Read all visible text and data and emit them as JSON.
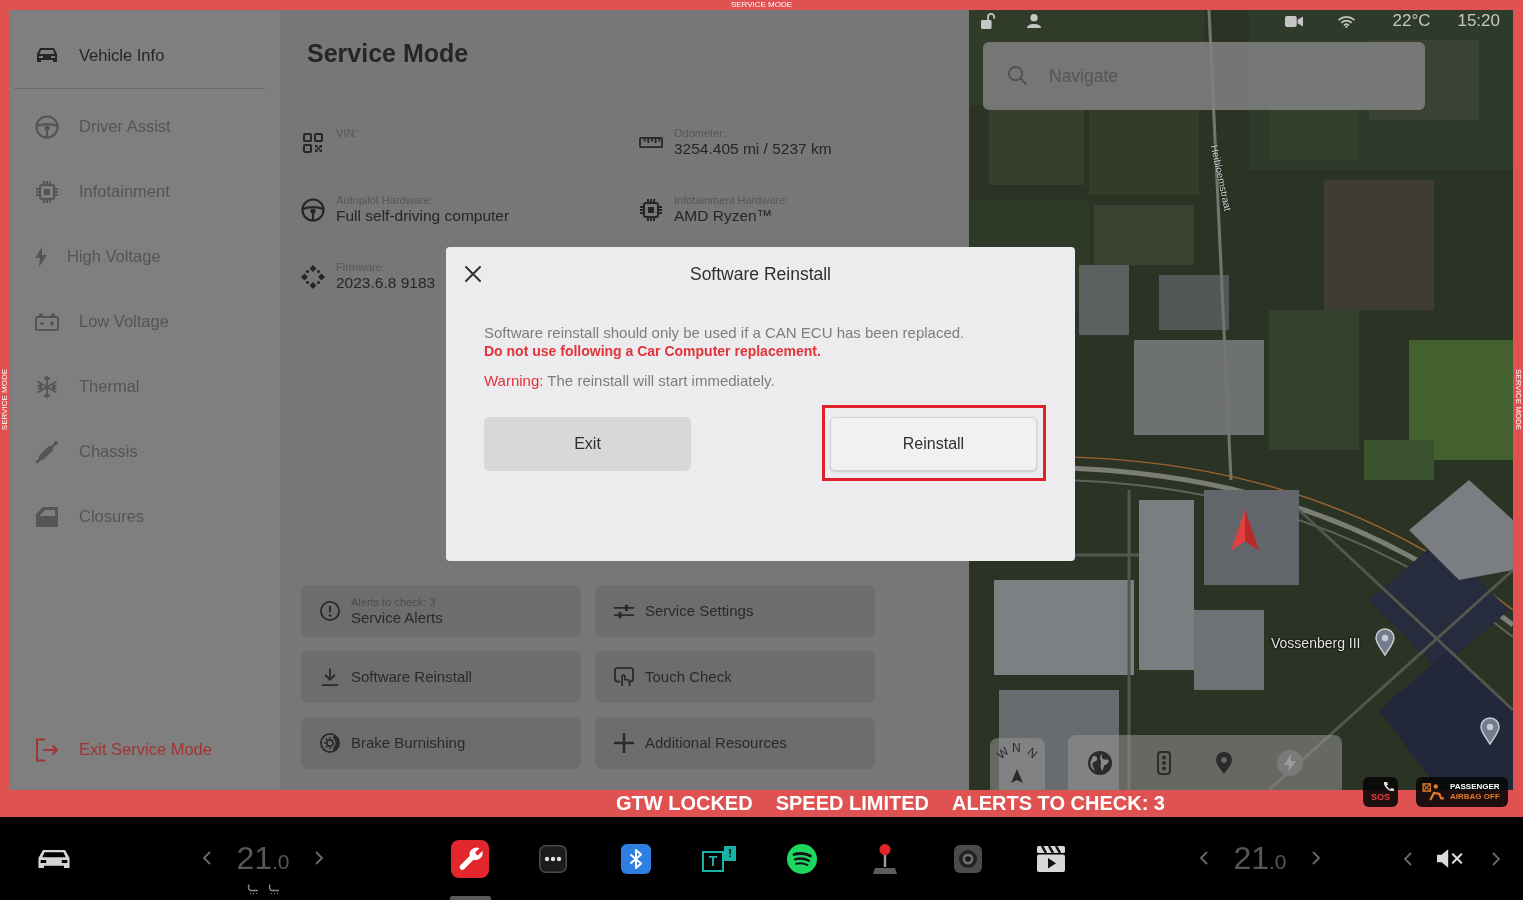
{
  "frame": {
    "top_label": "SERVICE MODE",
    "left_label": "SERVICE MODE",
    "right_label": "SERVICE MODE"
  },
  "sidebar": {
    "items": [
      {
        "kind": "car",
        "label": "Vehicle Info",
        "selected": true
      },
      {
        "kind": "steering",
        "label": "Driver Assist",
        "selected": false
      },
      {
        "kind": "chip",
        "label": "Infotainment",
        "selected": false
      },
      {
        "kind": "bolt",
        "label": "High Voltage",
        "selected": false
      },
      {
        "kind": "battery",
        "label": "Low Voltage",
        "selected": false
      },
      {
        "kind": "snowflake",
        "label": "Thermal",
        "selected": false
      },
      {
        "kind": "shock",
        "label": "Chassis",
        "selected": false
      },
      {
        "kind": "door",
        "label": "Closures",
        "selected": false
      }
    ],
    "exit": {
      "label": "Exit Service Mode"
    }
  },
  "main": {
    "title": "Service Mode",
    "fields": [
      {
        "kind": "qr",
        "label": "VIN:"
      },
      {
        "kind": "ruler",
        "label": "Odometer:",
        "value": "3254.405 mi / 5237 km"
      },
      {
        "kind": "steering",
        "label": "Autopilot Hardware:",
        "value": "Full self-driving computer"
      },
      {
        "kind": "chip",
        "label": "Infotainment Hardware:",
        "value": "AMD Ryzen™"
      },
      {
        "kind": "diamonds",
        "label": "Firmware:",
        "value": "2023.6.8 9183"
      }
    ],
    "actions": [
      {
        "kind": "alert",
        "caption": "Alerts to check: 3",
        "label": "Service Alerts"
      },
      {
        "kind": "sliders",
        "label": "Service Settings"
      },
      {
        "kind": "download",
        "label": "Software Reinstall"
      },
      {
        "kind": "touch",
        "label": "Touch Check"
      },
      {
        "kind": "brake",
        "label": "Brake Burnishing"
      },
      {
        "kind": "plus",
        "label": "Additional Resources"
      }
    ]
  },
  "modal": {
    "title": "Software Reinstall",
    "intro": "Software reinstall should only be used if a CAN ECU has been replaced.",
    "caution": "Do not use following a Car Computer replacement.",
    "warning": "**Warning:** The reinstall will start immediately.",
    "buttons": [
      {
        "kind": "secondary",
        "label": "Exit",
        "highlighted": false
      },
      {
        "kind": "primary",
        "label": "Reinstall",
        "highlighted": true
      }
    ]
  },
  "map": {
    "status": {
      "locked": false,
      "temperature": "22°C",
      "time": "15:20"
    },
    "search": {
      "placeholder": "Navigate"
    },
    "street_label": "Heibloemstraat",
    "place_label": "Vossenberg III",
    "compass": {
      "letters": [
        "W",
        "N",
        "N"
      ]
    },
    "controls": [
      {
        "kind": "globe"
      },
      {
        "kind": "traffic"
      },
      {
        "kind": "pin"
      },
      {
        "kind": "charging"
      }
    ]
  },
  "badges": {
    "sos": "SOS",
    "airbag": [
      "PASSENGER",
      "AIRBAG OFF"
    ]
  },
  "status_bar": [
    "GTW LOCKED",
    "SPEED LIMITED",
    "ALERTS TO CHECK: 3"
  ],
  "taskbar": {
    "climate": [
      {
        "whole": "21",
        "decimal": ".0",
        "seat_icons": true
      },
      {
        "whole": "21",
        "decimal": ".0"
      }
    ],
    "apps": [
      {
        "kind": "wrench",
        "selected": true
      },
      {
        "kind": "dots",
        "selected": false
      },
      {
        "kind": "bluetooth",
        "selected": false
      },
      {
        "kind": "letter",
        "glyph": "T",
        "badge": "!",
        "selected": false
      },
      {
        "kind": "waves",
        "selected": false
      },
      {
        "kind": "joystick",
        "selected": false
      },
      {
        "kind": "camera",
        "selected": false
      },
      {
        "kind": "clapper",
        "selected": false
      }
    ],
    "volume": {
      "muted": true
    }
  }
}
